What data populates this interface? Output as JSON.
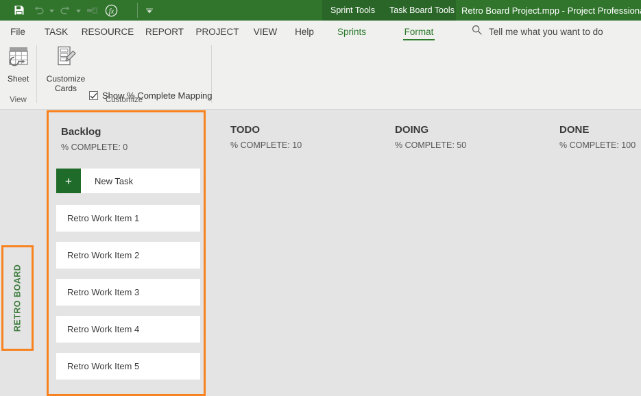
{
  "titlebar": {
    "quick_access": [
      {
        "name": "save-icon",
        "label": "Save"
      },
      {
        "name": "undo-icon",
        "label": "Undo"
      },
      {
        "name": "redo-icon",
        "label": "Redo"
      },
      {
        "name": "link-tasks-icon",
        "label": "Link Tasks"
      },
      {
        "name": "function-icon",
        "label": "Fx"
      }
    ],
    "customize_qat_label": "Customize Quick Access Toolbar",
    "contextual_tabs": [
      {
        "label": "Sprint Tools"
      },
      {
        "label": "Task Board Tools"
      }
    ],
    "document_title": "Retro Board Project.mpp  -  Project Professional"
  },
  "ribbon": {
    "tabs": [
      {
        "label": "File",
        "style": "normal"
      },
      {
        "label": "TASK",
        "style": "normal"
      },
      {
        "label": "RESOURCE",
        "style": "normal"
      },
      {
        "label": "REPORT",
        "style": "normal"
      },
      {
        "label": "PROJECT",
        "style": "normal"
      },
      {
        "label": "VIEW",
        "style": "normal"
      },
      {
        "label": "Help",
        "style": "normal"
      },
      {
        "label": "Sprints",
        "style": "green"
      },
      {
        "label": "Format",
        "style": "active"
      }
    ],
    "tell_me": {
      "icon": "search-icon",
      "placeholder": "Tell me what you want to do"
    },
    "groups": [
      {
        "title": "View"
      },
      {
        "title": "Customize"
      }
    ],
    "buttons": {
      "sheet": {
        "label": "Sheet",
        "icon": "sheet-icon"
      },
      "customize_cards": {
        "label": "Customize\nCards",
        "line1": "Customize",
        "line2": "Cards",
        "icon": "customize-cards-icon"
      }
    },
    "checkbox": {
      "label": "Show % Complete Mapping",
      "checked": true,
      "check_glyph": "✓"
    }
  },
  "board": {
    "side_tab": {
      "label": "RETRO BOARD"
    },
    "new_task": {
      "plus_glyph": "+",
      "label": "New Task"
    },
    "columns": [
      {
        "title": "Backlog",
        "percent_complete_label": "% COMPLETE: 0",
        "selected": true,
        "has_new_task": true,
        "cards": [
          {
            "title": "Retro Work Item 1"
          },
          {
            "title": "Retro Work Item 2"
          },
          {
            "title": "Retro Work Item 3"
          },
          {
            "title": "Retro Work Item 4"
          },
          {
            "title": "Retro Work Item 5"
          }
        ]
      },
      {
        "title": "TODO",
        "percent_complete_label": "% COMPLETE: 10",
        "selected": false,
        "has_new_task": false,
        "cards": []
      },
      {
        "title": "DOING",
        "percent_complete_label": "% COMPLETE: 50",
        "selected": false,
        "has_new_task": false,
        "cards": []
      },
      {
        "title": "DONE",
        "percent_complete_label": "% COMPLETE: 100",
        "selected": false,
        "has_new_task": false,
        "cards": []
      }
    ]
  },
  "colors": {
    "title_green": "#31752d",
    "contextual_green": "#2a6628",
    "accent_green": "#2c7a2c",
    "selection_orange": "#f7821f",
    "new_task_green": "#1f6b29",
    "board_bg": "#e4e4e4",
    "ribbon_bg": "#f0f0ef"
  }
}
